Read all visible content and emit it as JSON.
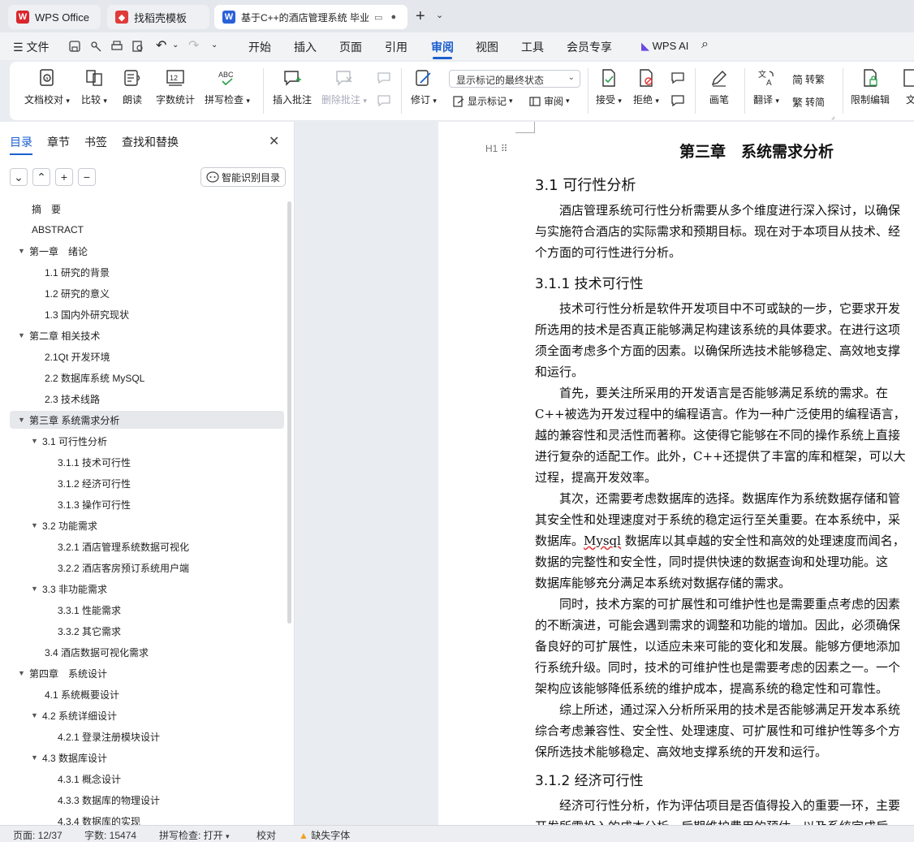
{
  "tabs": [
    {
      "label": "WPS Office",
      "icon": "wps-logo-icon",
      "color": "#d9262c"
    },
    {
      "label": "找稻壳模板",
      "icon": "docer-logo-icon",
      "color": "#e03b3b"
    },
    {
      "label": "基于C++的酒店管理系统 毕业",
      "icon": "word-logo-icon",
      "color": "#2a61d8"
    }
  ],
  "menubar": {
    "file": "文件",
    "items": [
      "开始",
      "插入",
      "页面",
      "引用",
      "审阅",
      "视图",
      "工具",
      "会员专享"
    ],
    "active": "审阅",
    "ai": "WPS AI"
  },
  "ribbon": {
    "doc_check": "文档校对",
    "compare": "比较",
    "read_aloud": "朗读",
    "word_count": "字数统计",
    "spell_check": "拼写检查",
    "insert_comment": "插入批注",
    "delete_comment": "删除批注",
    "revise": "修订",
    "markup_state": "显示标记的最终状态",
    "show_markup": "显示标记",
    "review": "审阅",
    "accept": "接受",
    "reject": "拒绝",
    "pen": "画笔",
    "translate": "翻译",
    "to_traditional": "转繁",
    "to_simplified": "转简",
    "restrict_edit": "限制编辑",
    "doc_more": "文"
  },
  "sidebar": {
    "tabs": [
      "目录",
      "章节",
      "书签",
      "查找和替换"
    ],
    "smart_toc": "智能识别目录",
    "toc": [
      {
        "label": "摘　要",
        "level": 0,
        "caret": false
      },
      {
        "label": "ABSTRACT",
        "level": 0,
        "caret": false
      },
      {
        "label": "第一章　绪论",
        "level": 0,
        "caret": true
      },
      {
        "label": "1.1 研究的背景",
        "level": 1,
        "caret": false
      },
      {
        "label": "1.2 研究的意义",
        "level": 1,
        "caret": false
      },
      {
        "label": "1.3 国内外研究现状",
        "level": 1,
        "caret": false
      },
      {
        "label": "第二章  相关技术",
        "level": 0,
        "caret": true
      },
      {
        "label": "2.1Qt 开发环境",
        "level": 1,
        "caret": false
      },
      {
        "label": "2.2 数据库系统 MySQL",
        "level": 1,
        "caret": false
      },
      {
        "label": "2.3 技术线路",
        "level": 1,
        "caret": false
      },
      {
        "label": "第三章  系统需求分析",
        "level": 0,
        "caret": true,
        "selected": true
      },
      {
        "label": "3.1 可行性分析",
        "level": 1,
        "caret": true
      },
      {
        "label": "3.1.1 技术可行性",
        "level": 2,
        "caret": false
      },
      {
        "label": "3.1.2 经济可行性",
        "level": 2,
        "caret": false
      },
      {
        "label": "3.1.3 操作可行性",
        "level": 2,
        "caret": false
      },
      {
        "label": "3.2 功能需求",
        "level": 1,
        "caret": true
      },
      {
        "label": "3.2.1 酒店管理系统数据可视化",
        "level": 2,
        "caret": false
      },
      {
        "label": "3.2.2 酒店客房预订系统用户端",
        "level": 2,
        "caret": false
      },
      {
        "label": "3.3 非功能需求",
        "level": 1,
        "caret": true
      },
      {
        "label": "3.3.1 性能需求",
        "level": 2,
        "caret": false
      },
      {
        "label": "3.3.2  其它需求",
        "level": 2,
        "caret": false
      },
      {
        "label": "3.4 酒店数据可视化需求",
        "level": 1,
        "caret": false
      },
      {
        "label": "第四章　系统设计",
        "level": 0,
        "caret": true
      },
      {
        "label": "4.1 系统概要设计",
        "level": 1,
        "caret": false
      },
      {
        "label": "4.2 系统详细设计",
        "level": 1,
        "caret": true
      },
      {
        "label": "4.2.1 登录注册模块设计",
        "level": 2,
        "caret": false
      },
      {
        "label": "4.3 数据库设计",
        "level": 1,
        "caret": true
      },
      {
        "label": "4.3.1 概念设计",
        "level": 2,
        "caret": false
      },
      {
        "label": "4.3.3 数据库的物理设计",
        "level": 2,
        "caret": false
      },
      {
        "label": "4.3.4 数据库的实现",
        "level": 2,
        "caret": false
      }
    ]
  },
  "document": {
    "heading_marker": "H1",
    "title": "第三章　系统需求分析",
    "h31": "3.1 可行性分析",
    "p1": [
      "　　酒店管理系统可行性分析需要从多个维度进行深入探讨，以确保",
      "与实施符合酒店的实际需求和预期目标。现在对于本项目从技术、经",
      "个方面的可行性进行分析。"
    ],
    "h311": "3.1.1 技术可行性",
    "p2": [
      "　　技术可行性分析是软件开发项目中不可或缺的一步，它要求开发",
      "所选用的技术是否真正能够满足构建该系统的具体要求。在进行这项",
      "须全面考虑多个方面的因素。以确保所选技术能够稳定、高效地支撑",
      "和运行。"
    ],
    "p3": [
      "　　首先，要关注所采用的开发语言是否能够满足系统的需求。在",
      "C++被选为开发过程中的编程语言。作为一种广泛使用的编程语言，",
      "越的兼容性和灵活性而著称。这使得它能够在不同的操作系统上直接",
      "进行复杂的适配工作。此外，C++还提供了丰富的库和框架，可以大",
      "过程，提高开发效率。"
    ],
    "p4_lines": [
      "　　其次，还需要考虑数据库的选择。数据库作为系统数据存储和管",
      "其安全性和处理速度对于系统的稳定运行至关重要。在本系统中，采"
    ],
    "p4_mysql_pre": "数据库。",
    "p4_mysql_word": "Mysql",
    "p4_mysql_post": " 数据库以其卓越的安全性和高效的处理速度而闻名，",
    "p4_tail": [
      "数据的完整性和安全性，同时提供快速的数据查询和处理功能。这",
      "数据库能够充分满足本系统对数据存储的需求。"
    ],
    "p5": [
      "　　同时，技术方案的可扩展性和可维护性也是需要重点考虑的因素",
      "的不断演进，可能会遇到需求的调整和功能的增加。因此，必须确保",
      "备良好的可扩展性，以适应未来可能的变化和发展。能够方便地添加",
      "行系统升级。同时，技术的可维护性也是需要考虑的因素之一。一个",
      "架构应该能够降低系统的维护成本，提高系统的稳定性和可靠性。"
    ],
    "p6": [
      "　　综上所述，通过深入分析所采用的技术是否能够满足开发本系统",
      "综合考虑兼容性、安全性、处理速度、可扩展性和可维护性等多个方",
      "保所选技术能够稳定、高效地支撑系统的开发和运行。"
    ],
    "h312": "3.1.2 经济可行性",
    "p7": [
      "　　经济可行性分析，作为评估项目是否值得投入的重要一环，主要",
      "开发所需投入的成本分析、后期维护费用的预估，以及系统完成后"
    ]
  },
  "statusbar": {
    "page": "页面: 12/37",
    "words": "字数: 15474",
    "spell": "拼写检查: 打开",
    "proof": "校对",
    "missing_font": "缺失字体"
  },
  "colors": {
    "accent": "#1a5fd0",
    "warning": "#f0a020"
  }
}
